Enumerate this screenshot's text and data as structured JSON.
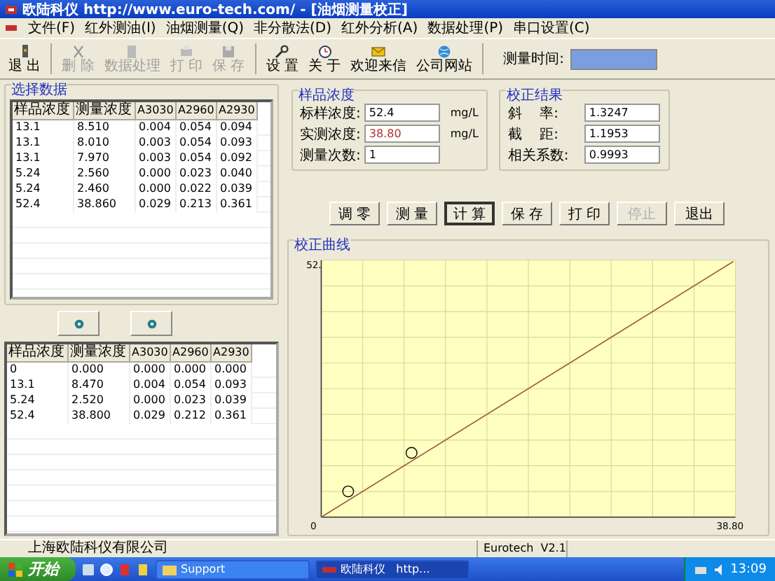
{
  "window": {
    "title": "欧陆科仪   http://www.euro-tech.com/ - [油烟测量校正]"
  },
  "menu": [
    "文件(F)",
    "红外测油(I)",
    "油烟测量(Q)",
    "非分散法(D)",
    "红外分析(A)",
    "数据处理(P)",
    "串口设置(C)"
  ],
  "toolbar": {
    "buttons": [
      {
        "label": "退 出",
        "disabled": false
      },
      {
        "label": "删 除",
        "disabled": true
      },
      {
        "label": "数据处理",
        "disabled": true
      },
      {
        "label": "打 印",
        "disabled": true
      },
      {
        "label": "保 存",
        "disabled": true
      },
      {
        "label": "设 置",
        "disabled": false
      },
      {
        "label": "关 于",
        "disabled": false
      },
      {
        "label": "欢迎来信",
        "disabled": false
      },
      {
        "label": "公司网站",
        "disabled": false
      }
    ],
    "time_label": "测量时间:"
  },
  "select_data": {
    "title": "选择数据",
    "columns": [
      "样品浓度",
      "测量浓度",
      "A3030",
      "A2960",
      "A2930"
    ],
    "rows": [
      [
        "13.1",
        "8.510",
        "0.004",
        "0.054",
        "0.094"
      ],
      [
        "13.1",
        "8.010",
        "0.003",
        "0.054",
        "0.093"
      ],
      [
        "13.1",
        "7.970",
        "0.003",
        "0.054",
        "0.092"
      ],
      [
        "5.24",
        "2.560",
        "0.000",
        "0.023",
        "0.040"
      ],
      [
        "5.24",
        "2.460",
        "0.000",
        "0.022",
        "0.039"
      ],
      [
        "52.4",
        "38.860",
        "0.029",
        "0.213",
        "0.361"
      ]
    ]
  },
  "used_data": {
    "columns": [
      "样品浓度",
      "测量浓度",
      "A3030",
      "A2960",
      "A2930"
    ],
    "rows": [
      [
        "0",
        "0.000",
        "0.000",
        "0.000",
        "0.000"
      ],
      [
        "13.1",
        "8.470",
        "0.004",
        "0.054",
        "0.093"
      ],
      [
        "5.24",
        "2.520",
        "0.000",
        "0.023",
        "0.039"
      ],
      [
        "52.4",
        "38.800",
        "0.029",
        "0.212",
        "0.361"
      ]
    ]
  },
  "sample": {
    "title": "样品浓度",
    "fields": [
      {
        "label": "标样浓度:",
        "value": "52.4",
        "unit": "mg/L",
        "color": "#000000"
      },
      {
        "label": "实测浓度:",
        "value": "38.80",
        "unit": "mg/L",
        "color": "#b03030"
      },
      {
        "label": "测量次数:",
        "value": "1",
        "color": "#000000"
      }
    ]
  },
  "results": {
    "title": "校正结果",
    "fields": [
      {
        "label": "斜    率:",
        "value": "1.3247"
      },
      {
        "label": "截    距:",
        "value": "1.1953"
      },
      {
        "label": "相关系数:",
        "value": "0.9993"
      }
    ]
  },
  "actions": [
    {
      "label": "调 零",
      "disabled": false,
      "focused": false
    },
    {
      "label": "测 量",
      "disabled": false,
      "focused": false
    },
    {
      "label": "计 算",
      "disabled": false,
      "focused": true
    },
    {
      "label": "保 存",
      "disabled": false,
      "focused": false
    },
    {
      "label": "打 印",
      "disabled": false,
      "focused": false
    },
    {
      "label": "停止",
      "disabled": true,
      "focused": false
    },
    {
      "label": "退出",
      "disabled": false,
      "focused": false
    }
  ],
  "chart": {
    "title": "校正曲线",
    "y_top_label": "52.",
    "origin_label": "0",
    "x_end_label": "38.80"
  },
  "status_bar": [
    "上海欧陆科仪有限公司",
    "Eurotech  V2.1"
  ],
  "taskbar": {
    "start": "开始",
    "tasks": [
      {
        "label": "Support",
        "active": false
      },
      {
        "label": "欧陆科仪   http...",
        "active": true
      }
    ],
    "clock": "13:09"
  }
}
